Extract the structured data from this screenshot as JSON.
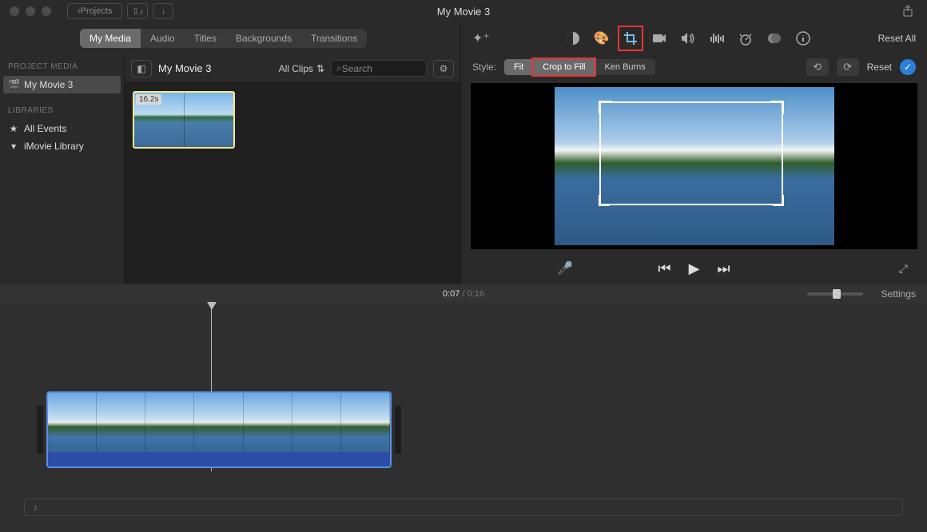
{
  "window_title": "My Movie 3",
  "toolbar": {
    "back_label": "Projects"
  },
  "tabs": [
    "My Media",
    "Audio",
    "Titles",
    "Backgrounds",
    "Transitions"
  ],
  "tabs_active": 0,
  "sidebar": {
    "section1": "PROJECT MEDIA",
    "project_item": "My Movie 3",
    "section2": "LIBRARIES",
    "lib_items": [
      "All Events",
      "iMovie Library"
    ]
  },
  "browser": {
    "title": "My Movie 3",
    "dropdown": "All Clips",
    "search_placeholder": "Search",
    "clip_duration": "16.2s"
  },
  "adjust": {
    "reset_all": "Reset All",
    "style_label": "Style:",
    "styles": [
      "Fit",
      "Crop to Fill",
      "Ken Burns"
    ],
    "reset": "Reset"
  },
  "playback": {
    "current": "0:07",
    "total": "0:16",
    "settings": "Settings"
  }
}
